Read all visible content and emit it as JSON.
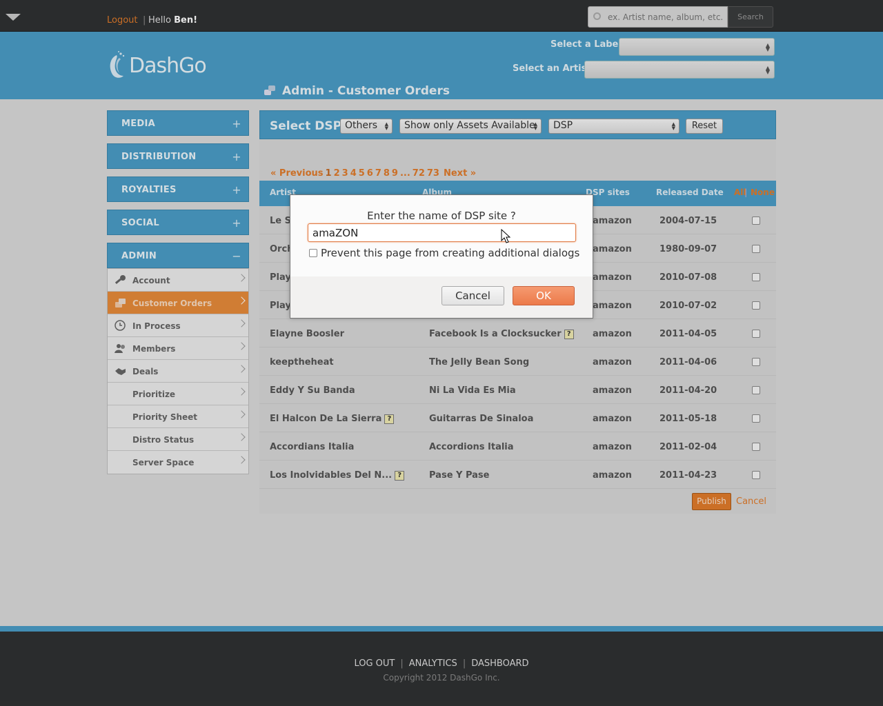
{
  "topbar": {
    "logout": "Logout",
    "separator": "|",
    "hello_prefix": "Hello",
    "user": "Ben!",
    "search_placeholder": "ex. Artist name, album, etc.",
    "search_button": "Search"
  },
  "header": {
    "logo_text": "DashGo",
    "label_select": "Select a Label",
    "artist_select": "Select an Artist",
    "page_title": "Admin - Customer Orders"
  },
  "sidebar": {
    "sections": [
      {
        "label": "MEDIA",
        "toggle": "+"
      },
      {
        "label": "DISTRIBUTION",
        "toggle": "+"
      },
      {
        "label": "ROYALTIES",
        "toggle": "+"
      },
      {
        "label": "SOCIAL",
        "toggle": "+"
      },
      {
        "label": "ADMIN",
        "toggle": "−"
      }
    ],
    "items": [
      {
        "label": "Account",
        "icon": "key-icon"
      },
      {
        "label": "Customer Orders",
        "icon": "orders-icon",
        "active": true
      },
      {
        "label": "In Process",
        "icon": "clock-icon"
      },
      {
        "label": "Members",
        "icon": "members-icon"
      },
      {
        "label": "Deals",
        "icon": "handshake-icon"
      },
      {
        "label": "Prioritize"
      },
      {
        "label": "Priority Sheet"
      },
      {
        "label": "Distro Status"
      },
      {
        "label": "Server Space"
      }
    ]
  },
  "dspbar": {
    "label": "Select DSP",
    "select1": "Others",
    "select2": "Show only Assets Available",
    "select3": "DSP",
    "reset": "Reset"
  },
  "pager": {
    "prev": "« Previous",
    "pages": [
      "1",
      "2",
      "3",
      "4",
      "5",
      "6",
      "7",
      "8",
      "9",
      "...",
      "72",
      "73"
    ],
    "next": "Next »"
  },
  "table": {
    "headers": {
      "artist": "Artist",
      "album": "Album",
      "dsp": "DSP sites",
      "date": "Released Date",
      "all": "All",
      "divider": "|",
      "none": "None"
    },
    "rows": [
      {
        "artist": "Le S",
        "album": "",
        "dsp": "amazon",
        "date": "2004-07-15",
        "aq": false,
        "bq": false
      },
      {
        "artist": "Orch",
        "album": "",
        "dsp": "amazon",
        "date": "1980-09-07",
        "aq": false,
        "bq": false
      },
      {
        "artist": "Play",
        "album": "",
        "dsp": "amazon",
        "date": "2010-07-08",
        "aq": false,
        "bq": false
      },
      {
        "artist": "Play",
        "album": "",
        "dsp": "amazon",
        "date": "2010-07-02",
        "aq": false,
        "bq": false
      },
      {
        "artist": "Elayne Boosler",
        "album": "Facebook Is a Clocksucker",
        "dsp": "amazon",
        "date": "2011-04-05",
        "aq": false,
        "bq": true
      },
      {
        "artist": "keeptheheat",
        "album": "The Jelly Bean Song",
        "dsp": "amazon",
        "date": "2011-04-06",
        "aq": false,
        "bq": false
      },
      {
        "artist": "Eddy Y Su Banda",
        "album": "Ni La Vida Es Mia",
        "dsp": "amazon",
        "date": "2011-04-20",
        "aq": false,
        "bq": false
      },
      {
        "artist": "El Halcon De La Sierra",
        "album": "Guitarras De Sinaloa",
        "dsp": "amazon",
        "date": "2011-05-18",
        "aq": true,
        "bq": false
      },
      {
        "artist": "Accordians Italia",
        "album": "Accordions Italia",
        "dsp": "amazon",
        "date": "2011-02-04",
        "aq": false,
        "bq": false
      },
      {
        "artist": "Los Inolvidables Del N...",
        "album": "Pase Y Pase",
        "dsp": "amazon",
        "date": "2011-04-23",
        "aq": true,
        "bq": false
      }
    ],
    "help_badge": "?",
    "publish": "Publish",
    "cancel": "Cancel"
  },
  "dialog": {
    "question": "Enter the name of DSP site ?",
    "input_value": "amaZON",
    "checkbox_label": "Prevent this page from creating additional dialogs",
    "cancel": "Cancel",
    "ok": "OK"
  },
  "footer": {
    "links": [
      "LOG OUT",
      "ANALYTICS",
      "DASHBOARD"
    ],
    "separator": "|",
    "copyright": "Copyright 2012 DashGo Inc."
  },
  "colors": {
    "accent": "#e07a2a",
    "brand_blue": "#4a9cc5",
    "dark": "#2f3132"
  }
}
